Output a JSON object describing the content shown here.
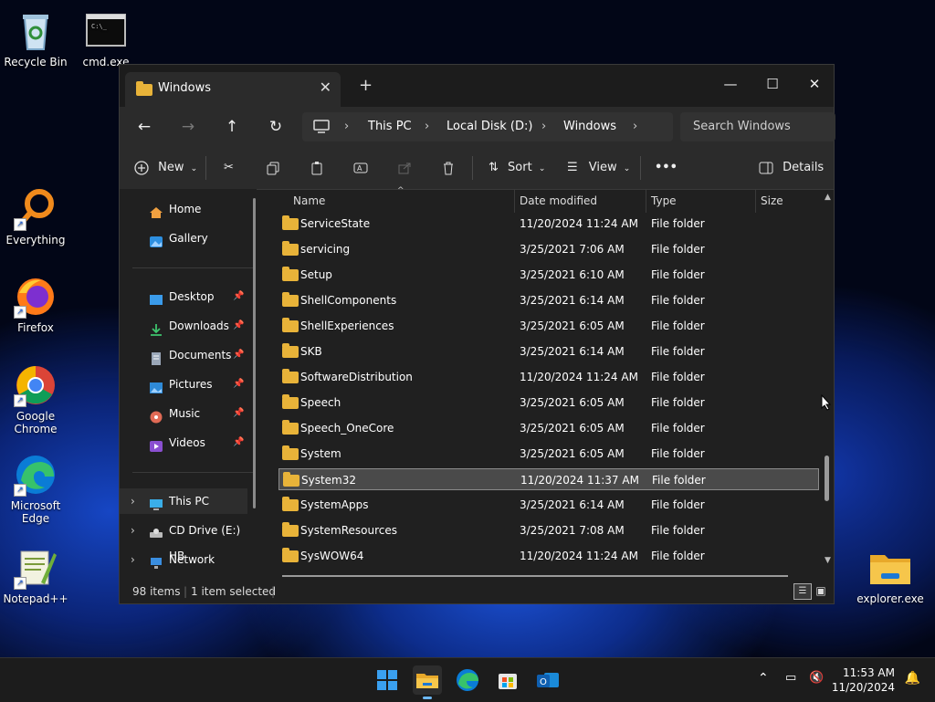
{
  "desktop": {
    "icons": [
      {
        "label": "Recycle Bin"
      },
      {
        "label": "cmd.exe"
      },
      {
        "label": "Everything"
      },
      {
        "label": "Firefox"
      },
      {
        "label": "Google Chrome"
      },
      {
        "label": "Microsoft Edge"
      },
      {
        "label": "Notepad++"
      },
      {
        "label": "explorer.exe"
      }
    ]
  },
  "window": {
    "tab_title": "Windows",
    "controls": {
      "minimize": "—",
      "maximize": "☐",
      "close": "✕"
    },
    "breadcrumb": [
      "This PC",
      "Local Disk (D:)",
      "Windows"
    ],
    "search_placeholder": "Search Windows",
    "commands": {
      "new": "New",
      "sort": "Sort",
      "view": "View",
      "more": "•••",
      "details": "Details"
    },
    "nav": {
      "home": "Home",
      "gallery": "Gallery",
      "desktop": "Desktop",
      "downloads": "Downloads",
      "documents": "Documents",
      "pictures": "Pictures",
      "music": "Music",
      "videos": "Videos",
      "this_pc": "This PC",
      "cd_drive": "CD Drive (E:) HB",
      "network": "Network"
    },
    "columns": {
      "name": "Name",
      "date": "Date modified",
      "type": "Type",
      "size": "Size"
    },
    "rows": [
      {
        "name": "ServiceState",
        "date": "11/20/2024 11:24 AM",
        "type": "File folder"
      },
      {
        "name": "servicing",
        "date": "3/25/2021 7:06 AM",
        "type": "File folder"
      },
      {
        "name": "Setup",
        "date": "3/25/2021 6:10 AM",
        "type": "File folder"
      },
      {
        "name": "ShellComponents",
        "date": "3/25/2021 6:14 AM",
        "type": "File folder"
      },
      {
        "name": "ShellExperiences",
        "date": "3/25/2021 6:05 AM",
        "type": "File folder"
      },
      {
        "name": "SKB",
        "date": "3/25/2021 6:14 AM",
        "type": "File folder"
      },
      {
        "name": "SoftwareDistribution",
        "date": "11/20/2024 11:24 AM",
        "type": "File folder"
      },
      {
        "name": "Speech",
        "date": "3/25/2021 6:05 AM",
        "type": "File folder"
      },
      {
        "name": "Speech_OneCore",
        "date": "3/25/2021 6:05 AM",
        "type": "File folder"
      },
      {
        "name": "System",
        "date": "3/25/2021 6:05 AM",
        "type": "File folder"
      },
      {
        "name": "System32",
        "date": "11/20/2024 11:37 AM",
        "type": "File folder",
        "selected": true
      },
      {
        "name": "SystemApps",
        "date": "3/25/2021 6:14 AM",
        "type": "File folder"
      },
      {
        "name": "SystemResources",
        "date": "3/25/2021 7:08 AM",
        "type": "File folder"
      },
      {
        "name": "SysWOW64",
        "date": "11/20/2024 11:24 AM",
        "type": "File folder"
      }
    ],
    "status": {
      "items": "98 items",
      "selected": "1 item selected"
    }
  },
  "taskbar": {
    "time": "11:53 AM",
    "date": "11/20/2024"
  },
  "colors": {
    "folder": "#e8b339",
    "selection": "#4a4a4a",
    "window_bg": "#202020"
  }
}
